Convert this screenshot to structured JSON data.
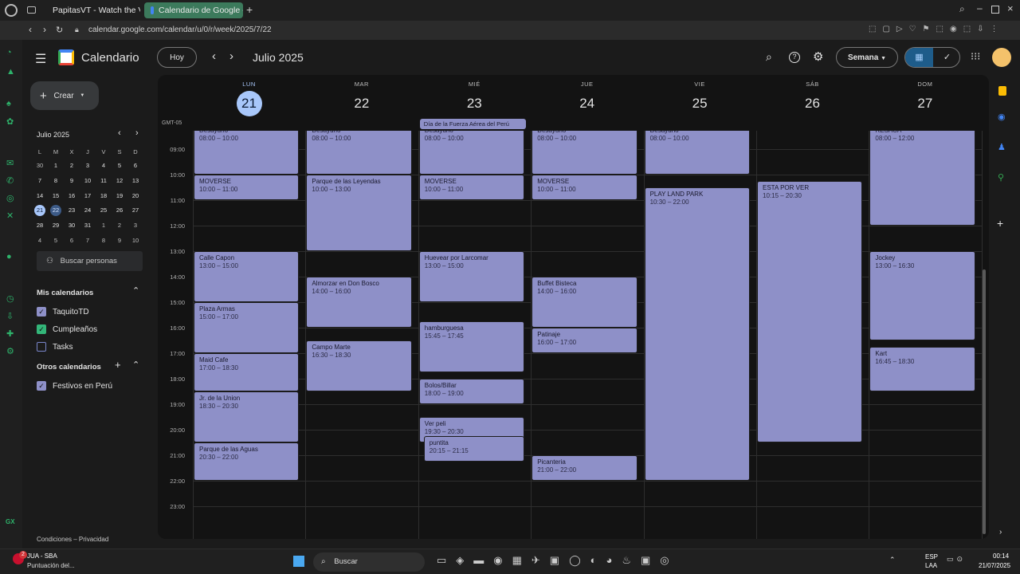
{
  "browser": {
    "tabs": [
      {
        "title": "PapitasVT - Watch the VO",
        "active": false
      },
      {
        "title": "Calendario de Google - S",
        "active": true
      }
    ],
    "url": "calendar.google.com/calendar/u/0/r/week/2025/7/22"
  },
  "header": {
    "app_name": "Calendario",
    "logo_day": "31",
    "today_label": "Hoy",
    "period_title": "Julio 2025",
    "view_label": "Semana"
  },
  "sidebar": {
    "create_label": "Crear",
    "mini_month": "Julio 2025",
    "weekday_letters": [
      "L",
      "M",
      "X",
      "J",
      "V",
      "S",
      "D"
    ],
    "weeks": [
      [
        "30",
        "1",
        "2",
        "3",
        "4",
        "5",
        "6"
      ],
      [
        "7",
        "8",
        "9",
        "10",
        "11",
        "12",
        "13"
      ],
      [
        "14",
        "15",
        "16",
        "17",
        "18",
        "19",
        "20"
      ],
      [
        "21",
        "22",
        "23",
        "24",
        "25",
        "26",
        "27"
      ],
      [
        "28",
        "29",
        "30",
        "31",
        "1",
        "2",
        "3"
      ],
      [
        "4",
        "5",
        "6",
        "7",
        "8",
        "9",
        "10"
      ]
    ],
    "search_people": "Buscar personas",
    "my_calendars_title": "Mis calendarios",
    "my_calendars": [
      {
        "name": "TaquitoTD",
        "color": "#8e90c8",
        "checked": true
      },
      {
        "name": "Cumpleaños",
        "color": "#33b679",
        "checked": true
      },
      {
        "name": "Tasks",
        "color": "#7986cb",
        "checked": false
      }
    ],
    "other_calendars_title": "Otros calendarios",
    "other_calendars": [
      {
        "name": "Festivos en Perú",
        "color": "#8e90c8",
        "checked": true
      }
    ],
    "footer": "Condiciones – Privacidad"
  },
  "grid": {
    "timezone": "GMT-05",
    "hours": [
      "08:00",
      "09:00",
      "10:00",
      "11:00",
      "12:00",
      "13:00",
      "14:00",
      "15:00",
      "16:00",
      "17:00",
      "18:00",
      "19:00",
      "20:00",
      "21:00",
      "22:00",
      "23:00"
    ],
    "days": [
      {
        "name": "LUN",
        "date": "21",
        "today": true
      },
      {
        "name": "MAR",
        "date": "22",
        "today": false
      },
      {
        "name": "MIÉ",
        "date": "23",
        "today": false
      },
      {
        "name": "JUE",
        "date": "24",
        "today": false
      },
      {
        "name": "VIE",
        "date": "25",
        "today": false
      },
      {
        "name": "SÁB",
        "date": "26",
        "today": false
      },
      {
        "name": "DOM",
        "date": "27",
        "today": false
      }
    ],
    "all_day": [
      {
        "day": 2,
        "title": "Día de la Fuerza Aérea del Perú"
      }
    ],
    "events": [
      {
        "day": 0,
        "title": "Desayuno",
        "time": "08:00 – 10:00",
        "start": 8,
        "end": 10
      },
      {
        "day": 0,
        "title": "MOVERSE",
        "time": "10:00 – 11:00",
        "start": 10,
        "end": 11
      },
      {
        "day": 0,
        "title": "Calle Capon",
        "time": "13:00 – 15:00",
        "start": 13,
        "end": 15
      },
      {
        "day": 0,
        "title": "Plaza Armas",
        "time": "15:00 – 17:00",
        "start": 15,
        "end": 17
      },
      {
        "day": 0,
        "title": "Maid Cafe",
        "time": "17:00 – 18:30",
        "start": 17,
        "end": 18.5
      },
      {
        "day": 0,
        "title": "Jr. de la Union",
        "time": "18:30 – 20:30",
        "start": 18.5,
        "end": 20.5
      },
      {
        "day": 0,
        "title": "Parque de las Aguas",
        "time": "20:30 – 22:00",
        "start": 20.5,
        "end": 22
      },
      {
        "day": 1,
        "title": "Desayuno",
        "time": "08:00 – 10:00",
        "start": 8,
        "end": 10
      },
      {
        "day": 1,
        "title": "Parque de las Leyendas",
        "time": "10:00 – 13:00",
        "start": 10,
        "end": 13
      },
      {
        "day": 1,
        "title": "Almorzar en Don Bosco",
        "time": "14:00 – 16:00",
        "start": 14,
        "end": 16
      },
      {
        "day": 1,
        "title": "Campo Marte",
        "time": "16:30 – 18:30",
        "start": 16.5,
        "end": 18.5
      },
      {
        "day": 2,
        "title": "Desayuno",
        "time": "08:00 – 10:00",
        "start": 8,
        "end": 10
      },
      {
        "day": 2,
        "title": "MOVERSE",
        "time": "10:00 – 11:00",
        "start": 10,
        "end": 11
      },
      {
        "day": 2,
        "title": "Huevear por Larcomar",
        "time": "13:00 – 15:00",
        "start": 13,
        "end": 15
      },
      {
        "day": 2,
        "title": "hamburguesa",
        "time": "15:45 – 17:45",
        "start": 15.75,
        "end": 17.75
      },
      {
        "day": 2,
        "title": "Bolos/Billar",
        "time": "18:00 – 19:00",
        "start": 18,
        "end": 19
      },
      {
        "day": 2,
        "title": "Ver peli",
        "time": "19:30 – 20:30",
        "start": 19.5,
        "end": 20.5
      },
      {
        "day": 2,
        "title": "puntita",
        "time": "20:15 – 21:15",
        "start": 20.25,
        "end": 21.25,
        "offset": true
      },
      {
        "day": 3,
        "title": "Desayuno",
        "time": "08:00 – 10:00",
        "start": 8,
        "end": 10
      },
      {
        "day": 3,
        "title": "MOVERSE",
        "time": "10:00 – 11:00",
        "start": 10,
        "end": 11
      },
      {
        "day": 3,
        "title": "Buffet Bisteca",
        "time": "14:00 – 16:00",
        "start": 14,
        "end": 16
      },
      {
        "day": 3,
        "title": "Patinaje",
        "time": "16:00 – 17:00",
        "start": 16,
        "end": 17
      },
      {
        "day": 3,
        "title": "Picanteria",
        "time": "21:00 – 22:00",
        "start": 21,
        "end": 22
      },
      {
        "day": 4,
        "title": "Desayuno",
        "time": "08:00 – 10:00",
        "start": 8,
        "end": 10
      },
      {
        "day": 4,
        "title": "PLAY LAND PARK",
        "time": "10:30 – 22:00",
        "start": 10.5,
        "end": 22
      },
      {
        "day": 5,
        "title": "ESTA POR VER",
        "time": "10:15 – 20:30",
        "start": 10.25,
        "end": 20.5
      },
      {
        "day": 6,
        "title": "RESACA",
        "time": "08:00 – 12:00",
        "start": 8,
        "end": 12
      },
      {
        "day": 6,
        "title": "Jockey",
        "time": "13:00 – 16:30",
        "start": 13,
        "end": 16.5
      },
      {
        "day": 6,
        "title": "Kart",
        "time": "16:45 – 18:30",
        "start": 16.75,
        "end": 18.5
      }
    ]
  },
  "taskbar": {
    "notif_count": "2",
    "match_title": "JUA - SBA",
    "match_sub": "Puntuación del...",
    "search_label": "Buscar",
    "lang": "ESP",
    "lang_sub": "LAA",
    "time": "00:14",
    "date": "21/07/2025"
  }
}
